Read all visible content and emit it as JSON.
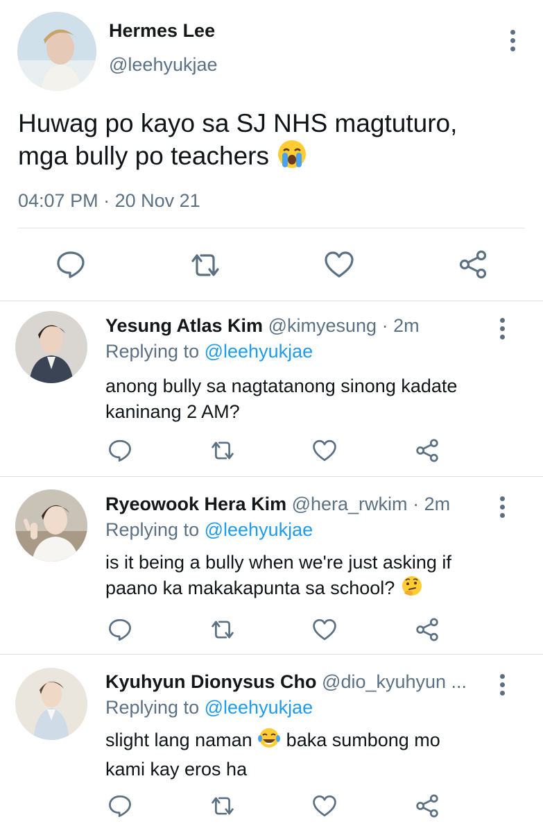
{
  "main_tweet": {
    "author_name": "Hermes Lee",
    "handle": "@leehyukjae",
    "text_line1": "Huwag po kayo sa SJ NHS magtuturo,",
    "text_line2": "mga bully po teachers",
    "text_emoji": "loudly-crying-face",
    "time": "04:07 PM",
    "separator": "·",
    "date": "20 Nov 21",
    "actions": [
      "reply-icon",
      "retweet-icon",
      "like-icon",
      "share-icon"
    ]
  },
  "replies": [
    {
      "author_name": "Yesung Atlas Kim",
      "handle": "@kimyesung",
      "dot": "·",
      "time": "2m",
      "replying_prefix": "Replying to",
      "replying_to": "@leehyukjae",
      "text_line1": "anong bully sa nagtatanong sinong kadate",
      "text_line2": "kaninang 2 AM?"
    },
    {
      "author_name": "Ryeowook Hera Kim",
      "handle": "@hera_rwkim",
      "dot": "·",
      "time": "2m",
      "replying_prefix": "Replying to",
      "replying_to": "@leehyukjae",
      "text_line1": "is it being a bully when we're just asking if",
      "text_line2": "paano ka makakapunta sa school?",
      "text_emoji": "thinking-face"
    },
    {
      "author_name": "Kyuhyun Dionysus Cho",
      "handle": "@dio_kyuhyun ...",
      "replying_prefix": "Replying to",
      "replying_to": "@leehyukjae",
      "text_line1_a": "slight lang naman",
      "text_emoji": "tears-of-joy-face",
      "text_line1_b": "baka sumbong mo",
      "text_line2": "kami kay eros ha"
    }
  ],
  "colors": {
    "link": "#1d9bf0",
    "muted": "#5b7083",
    "divider": "#dfe3e7",
    "text": "#0f1419"
  }
}
